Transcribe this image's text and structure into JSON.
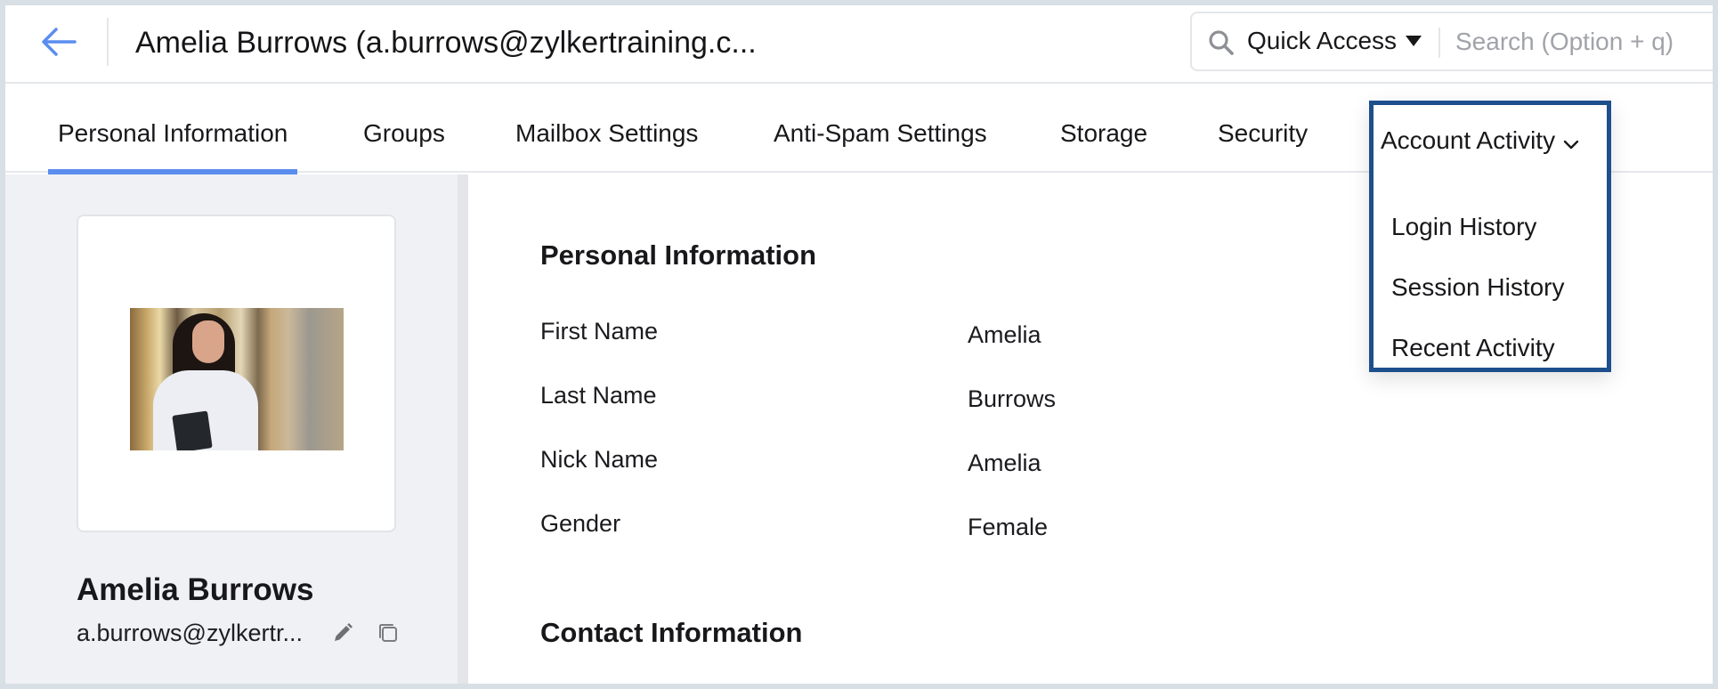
{
  "header": {
    "title": "Amelia Burrows (a.burrows@zylkertraining.c...",
    "back_icon": "arrow-left-icon",
    "quick_access_label": "Quick Access",
    "search_placeholder": "Search (Option + q)",
    "search_value": ""
  },
  "tabs": [
    {
      "label": "Personal Information",
      "active": true
    },
    {
      "label": "Groups",
      "active": false
    },
    {
      "label": "Mailbox Settings",
      "active": false
    },
    {
      "label": "Anti-Spam Settings",
      "active": false
    },
    {
      "label": "Storage",
      "active": false
    },
    {
      "label": "Security",
      "active": false
    },
    {
      "label": "Account Activity",
      "active": false,
      "has_dropdown": true
    }
  ],
  "account_activity_menu": {
    "items": [
      "Login History",
      "Session History",
      "Recent Activity"
    ]
  },
  "profile": {
    "name": "Amelia Burrows",
    "email": "a.burrows@zylkertr...",
    "edit_icon": "pencil-icon",
    "copy_icon": "copy-icon"
  },
  "personal_information": {
    "title": "Personal Information",
    "fields": [
      {
        "label": "First Name",
        "value": "Amelia"
      },
      {
        "label": "Last Name",
        "value": "Burrows"
      },
      {
        "label": "Nick Name",
        "value": "Amelia"
      },
      {
        "label": "Gender",
        "value": "Female"
      }
    ]
  },
  "contact_information": {
    "title": "Contact Information"
  },
  "colors": {
    "accent": "#5b8def",
    "highlight_border": "#1d4f8d",
    "panel_bg": "#eff1f4",
    "frame_bg": "#d8dfe5"
  }
}
